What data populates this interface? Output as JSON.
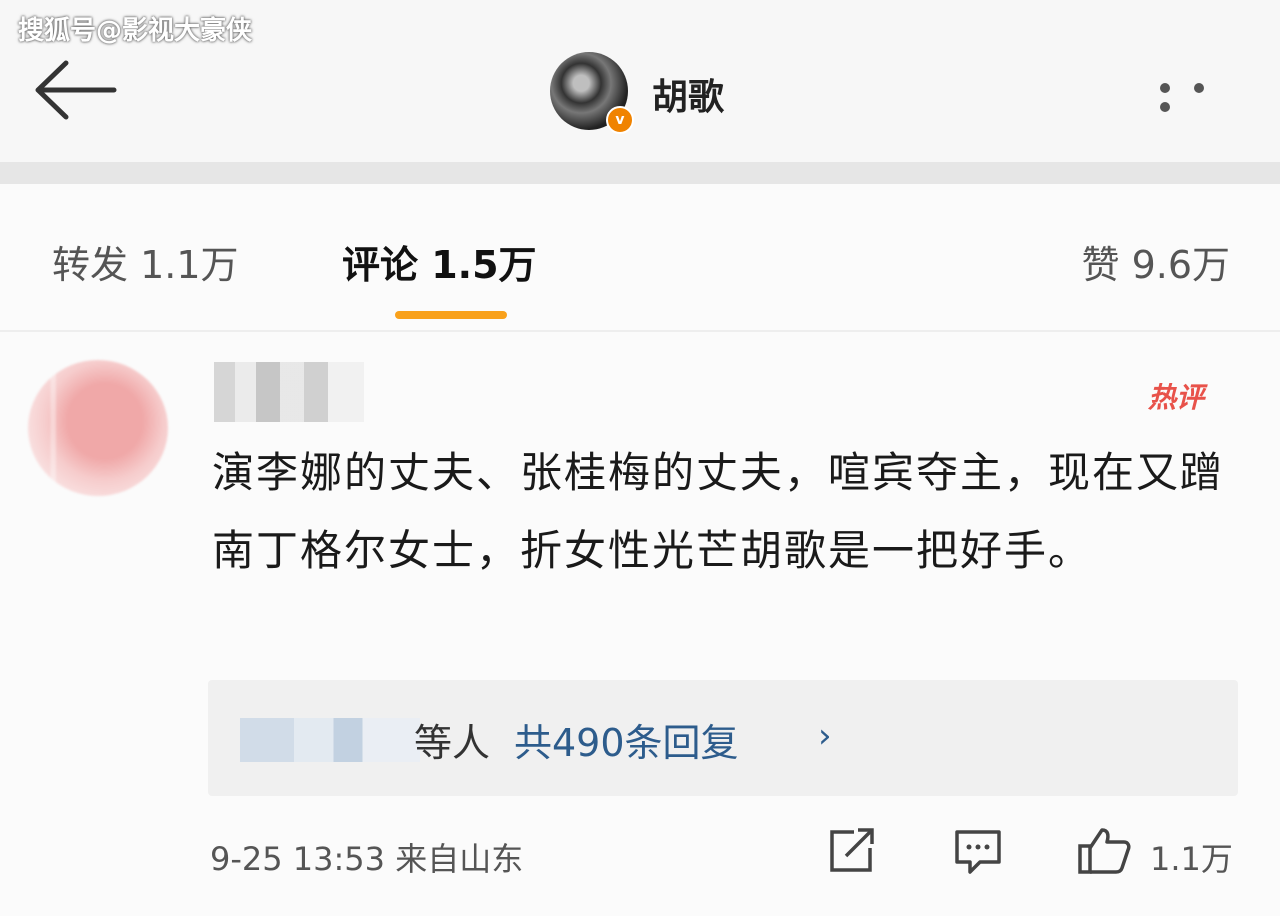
{
  "watermark": "搜狐号@影视大豪侠",
  "header": {
    "title": "胡歌",
    "verified_badge": "v"
  },
  "tabs": {
    "repost": "转发 1.1万",
    "comments": "评论 1.5万",
    "likes": "赞 9.6万",
    "active": "comments"
  },
  "comment": {
    "hot_label": "热评",
    "text": "演李娜的丈夫、张桂梅的丈夫，喧宾夺主，现在又蹭南丁格尔女士，折女性光芒胡歌是一把好手。",
    "replies": {
      "person_suffix": "等人",
      "count_label": "共490条回复",
      "chevron": "›"
    },
    "meta": "9-25 13:53 来自山东",
    "like_count": "1.1万"
  },
  "icons": {
    "back": "arrow-left-icon",
    "more": "more-dots-icon",
    "share": "share-icon",
    "comment": "comment-icon",
    "like": "thumbs-up-icon"
  },
  "colors": {
    "tab_indicator": "#f9a11b",
    "reply_link": "#2d5c8c",
    "hot": "#e8524a",
    "verified": "#f08300"
  }
}
